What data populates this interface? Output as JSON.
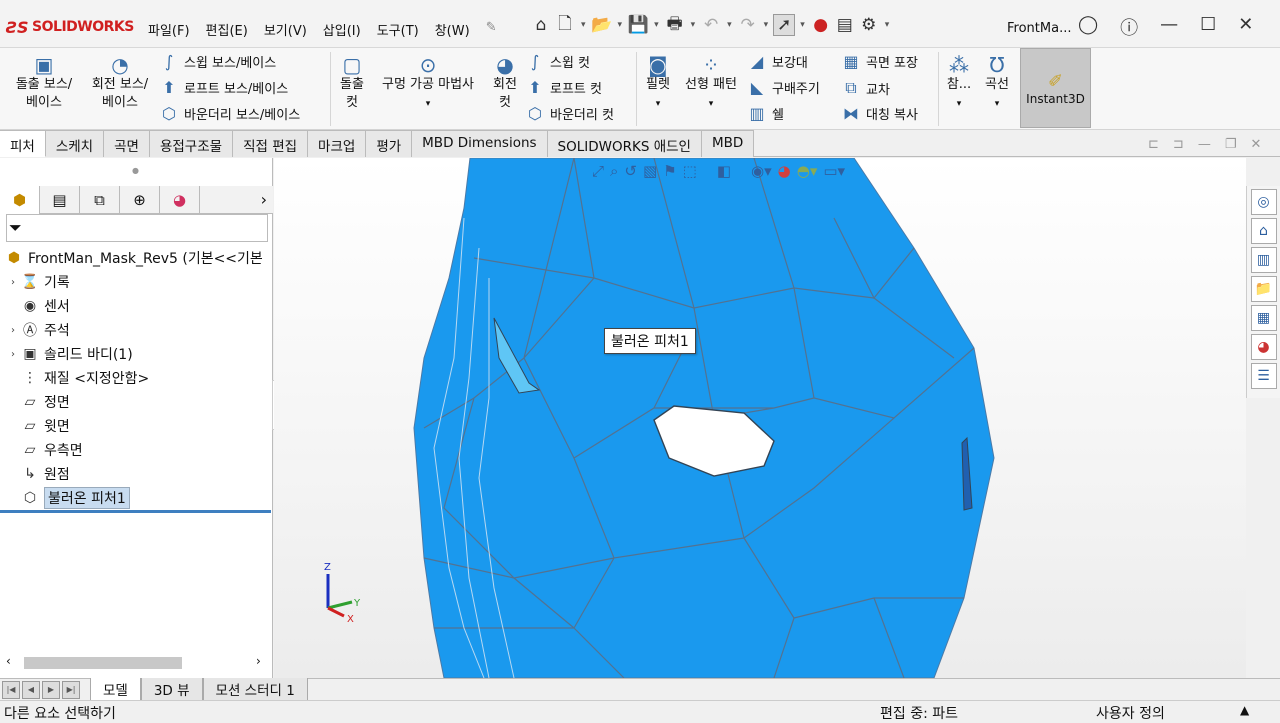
{
  "app": {
    "brand": "SOLIDWORKS",
    "file_title": "FrontMa..."
  },
  "menu": [
    "파일(F)",
    "편집(E)",
    "보기(V)",
    "삽입(I)",
    "도구(T)",
    "창(W)"
  ],
  "ribbon": {
    "extrude_boss": "돌출 보스/\n베이스",
    "revolve_boss": "회전 보스/\n베이스",
    "sweep_boss": "스윕 보스/베이스",
    "loft_boss": "로프트 보스/베이스",
    "boundary_boss": "바운더리 보스/베이스",
    "extrude_cut": "돌출\n컷",
    "hole_wizard": "구멍 가공 마법사",
    "revolve_cut": "회전\n컷",
    "sweep_cut": "스윕 컷",
    "loft_cut": "로프트 컷",
    "boundary_cut": "바운더리 컷",
    "fillet": "필렛",
    "linear_pattern": "선형 패턴",
    "rib": "보강대",
    "draft": "구배주기",
    "shell": "쉘",
    "wrap": "곡면 포장",
    "intersect": "교차",
    "mirror": "대칭 복사",
    "reference": "참...",
    "curves": "곡선",
    "instant3d": "Instant3D"
  },
  "cm_tabs": [
    "피처",
    "스케치",
    "곡면",
    "용접구조물",
    "직접 편집",
    "마크업",
    "평가",
    "MBD Dimensions",
    "SOLIDWORKS 애드인",
    "MBD"
  ],
  "tree": {
    "root": "FrontMan_Mask_Rev5  (기본<<기본",
    "items": [
      {
        "label": "기록",
        "expand": true
      },
      {
        "label": "센서",
        "expand": false
      },
      {
        "label": "주석",
        "expand": true
      },
      {
        "label": "솔리드 바디(1)",
        "expand": true
      },
      {
        "label": "재질 <지정안함>",
        "expand": false
      },
      {
        "label": "정면",
        "expand": false
      },
      {
        "label": "윗면",
        "expand": false
      },
      {
        "label": "우측면",
        "expand": false
      },
      {
        "label": "원점",
        "expand": false
      },
      {
        "label": "불러온 피처1",
        "expand": false,
        "selected": true
      }
    ]
  },
  "tooltip": "불러온 피처1",
  "triad": {
    "x": "X",
    "y": "Y",
    "z": "Z"
  },
  "bottom_tabs": [
    "모델",
    "3D 뷰",
    "모션 스터디 1"
  ],
  "status": {
    "left": "다른 요소 선택하기",
    "mid": "편집 중: 파트",
    "right": "사용자 정의"
  },
  "colors": {
    "model_fill": "#1a99ee",
    "model_edge": "#5a6e86",
    "accent": "#3e7fc0"
  }
}
